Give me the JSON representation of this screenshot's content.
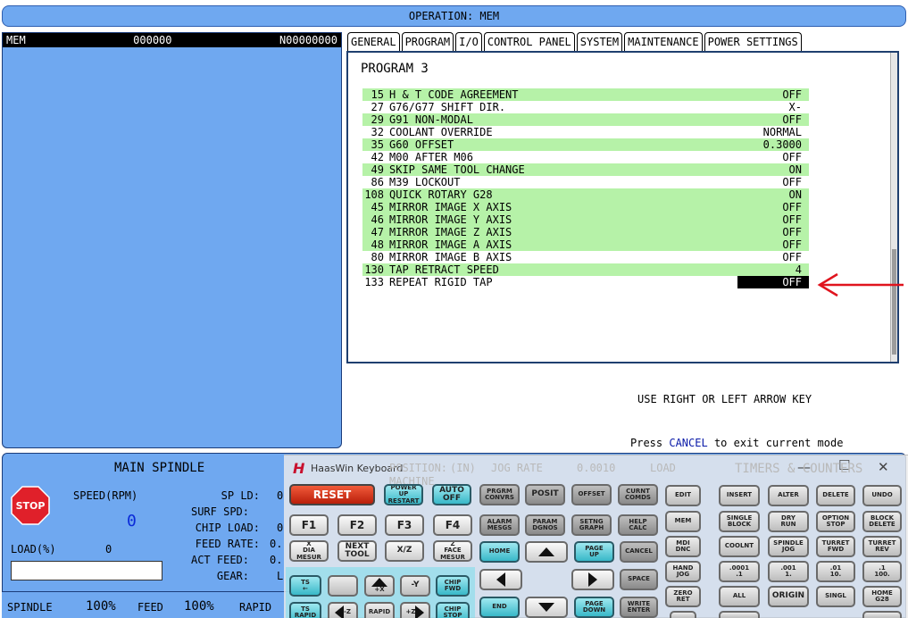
{
  "header": {
    "operation": "OPERATION: MEM"
  },
  "left_panel": {
    "mode": "MEM",
    "program_number": "000000",
    "sequence": "N00000000"
  },
  "tabs": [
    "GENERAL",
    "PROGRAM",
    "I/O",
    "CONTROL PANEL",
    "SYSTEM",
    "MAINTENANCE",
    "POWER SETTINGS"
  ],
  "active_tab": "PROGRAM",
  "program": {
    "title": "PROGRAM 3",
    "rows": [
      {
        "num": "15",
        "name": "H & T CODE AGREEMENT",
        "value": "OFF",
        "green": true,
        "selected": false
      },
      {
        "num": "27",
        "name": "G76/G77 SHIFT DIR.",
        "value": "X-",
        "green": false,
        "selected": false
      },
      {
        "num": "29",
        "name": "G91 NON-MODAL",
        "value": "OFF",
        "green": true,
        "selected": false
      },
      {
        "num": "32",
        "name": "COOLANT OVERRIDE",
        "value": "NORMAL",
        "green": false,
        "selected": false
      },
      {
        "num": "35",
        "name": "G60 OFFSET",
        "value": "0.3000",
        "green": true,
        "selected": false
      },
      {
        "num": "42",
        "name": "M00 AFTER M06",
        "value": "OFF",
        "green": false,
        "selected": false
      },
      {
        "num": "49",
        "name": "SKIP SAME TOOL CHANGE",
        "value": "ON",
        "green": true,
        "selected": false
      },
      {
        "num": "86",
        "name": "M39 LOCKOUT",
        "value": "OFF",
        "green": false,
        "selected": false
      },
      {
        "num": "108",
        "name": "QUICK ROTARY G28",
        "value": "ON",
        "green": true,
        "selected": false
      },
      {
        "num": "45",
        "name": "MIRROR IMAGE X AXIS",
        "value": "OFF",
        "green": true,
        "selected": false
      },
      {
        "num": "46",
        "name": "MIRROR IMAGE Y AXIS",
        "value": "OFF",
        "green": true,
        "selected": false
      },
      {
        "num": "47",
        "name": "MIRROR IMAGE Z AXIS",
        "value": "OFF",
        "green": true,
        "selected": false
      },
      {
        "num": "48",
        "name": "MIRROR IMAGE A AXIS",
        "value": "OFF",
        "green": true,
        "selected": false
      },
      {
        "num": "80",
        "name": "MIRROR IMAGE B AXIS",
        "value": "OFF",
        "green": false,
        "selected": false
      },
      {
        "num": "130",
        "name": "TAP RETRACT SPEED",
        "value": "4",
        "green": true,
        "selected": false
      },
      {
        "num": "133",
        "name": "REPEAT RIGID TAP",
        "value": "OFF",
        "green": false,
        "selected": true
      }
    ]
  },
  "hints": {
    "line1": "USE RIGHT OR LEFT ARROW KEY",
    "line2_pre": "Press ",
    "line2_key": "CANCEL",
    "line2_post": " to exit current mode"
  },
  "spindle": {
    "title": "MAIN SPINDLE",
    "stop": "STOP",
    "speed_label": "SPEED(RPM)",
    "speed_value": "0",
    "sp_ld_label": "SP LD:",
    "sp_ld_value": "0",
    "surf_spd_label": "SURF SPD:",
    "chip_load_label": "CHIP LOAD:",
    "chip_load_value": "0",
    "feed_rate_label": "FEED RATE:",
    "feed_rate_value": "0.",
    "act_feed_label": "ACT FEED:",
    "act_feed_value": "0.",
    "gear_label": "GEAR:",
    "gear_value": "L",
    "load_label": "LOAD(%)",
    "load_value": "0"
  },
  "footer": {
    "spindle_label": "SPINDLE",
    "spindle_pct": "100%",
    "feed_label": "FEED",
    "feed_pct": "100%",
    "rapid_label": "RAPID"
  },
  "keyboard": {
    "title": "HaasWin Keyboard",
    "logo": "H",
    "minimize": "—",
    "maximize": "☐",
    "close": "✕",
    "ghost": {
      "position": "POSITION:",
      "in": "(IN)",
      "jog_rate_label": "JOG RATE",
      "jog_rate": "0.0010",
      "load": "LOAD",
      "timers": "TIMERS & COUNTERS",
      "machine": "MACHINE"
    },
    "keys": {
      "reset": "RESET",
      "power_up": "POWER\nUP\nRESTART",
      "auto_off": "AUTO\nOFF",
      "f1": "F1",
      "f2": "F2",
      "f3": "F3",
      "f4": "F4",
      "x_dia": "X\nDIA\nMESUR",
      "next_tool": "NEXT\nTOOL",
      "xz": "X/Z",
      "z_face": "Z\nFACE\nMESUR",
      "ts_left": "TS\n←",
      "plus_x": "+X",
      "minus_y": "-Y",
      "chip_fwd": "CHIP\nFWD",
      "ts_rapid": "TS\nRAPID",
      "minus_z": "-Z",
      "rapid": "RAPID",
      "plus_z": "+Z",
      "chip_stop": "CHIP\nSTOP",
      "prgrm": "PRGRM\nCONVRS",
      "posit": "POSIT",
      "offset": "OFFSET",
      "curnt": "CURNT\nCOMDS",
      "alarm": "ALARM\nMESGS",
      "param": "PARAM\nDGNOS",
      "setng": "SETNG\nGRAPH",
      "help": "HELP\nCALC",
      "home": "HOME",
      "page_up": "PAGE\nUP",
      "cancel": "CANCEL",
      "space": "SPACE",
      "end": "END",
      "page_down": "PAGE\nDOWN",
      "write": "WRITE\nENTER",
      "edit": "EDIT",
      "insert": "INSERT",
      "alter": "ALTER",
      "delete": "DELETE",
      "undo": "UNDO",
      "mem": "MEM",
      "single": "SINGLE\nBLOCK",
      "dry": "DRY\nRUN",
      "option": "OPTION\nSTOP",
      "block": "BLOCK\nDELETE",
      "mdi": "MDI\nDNC",
      "coolnt": "COOLNT",
      "spindle_jog": "SPINDLE\nJOG",
      "turret_fwd": "TURRET\nFWD",
      "turret_rev": "TURRET\nREV",
      "hand": "HAND\nJOG",
      "j0001": ".0001\n.1",
      "j001": ".001\n1.",
      "j01": ".01\n10.",
      "j1": ".1\n100.",
      "zero": "ZERO\nRET",
      "all": "ALL",
      "origin": "ORIGIN",
      "singl": "SINGL",
      "home_g28": "HOME\nG28"
    }
  }
}
